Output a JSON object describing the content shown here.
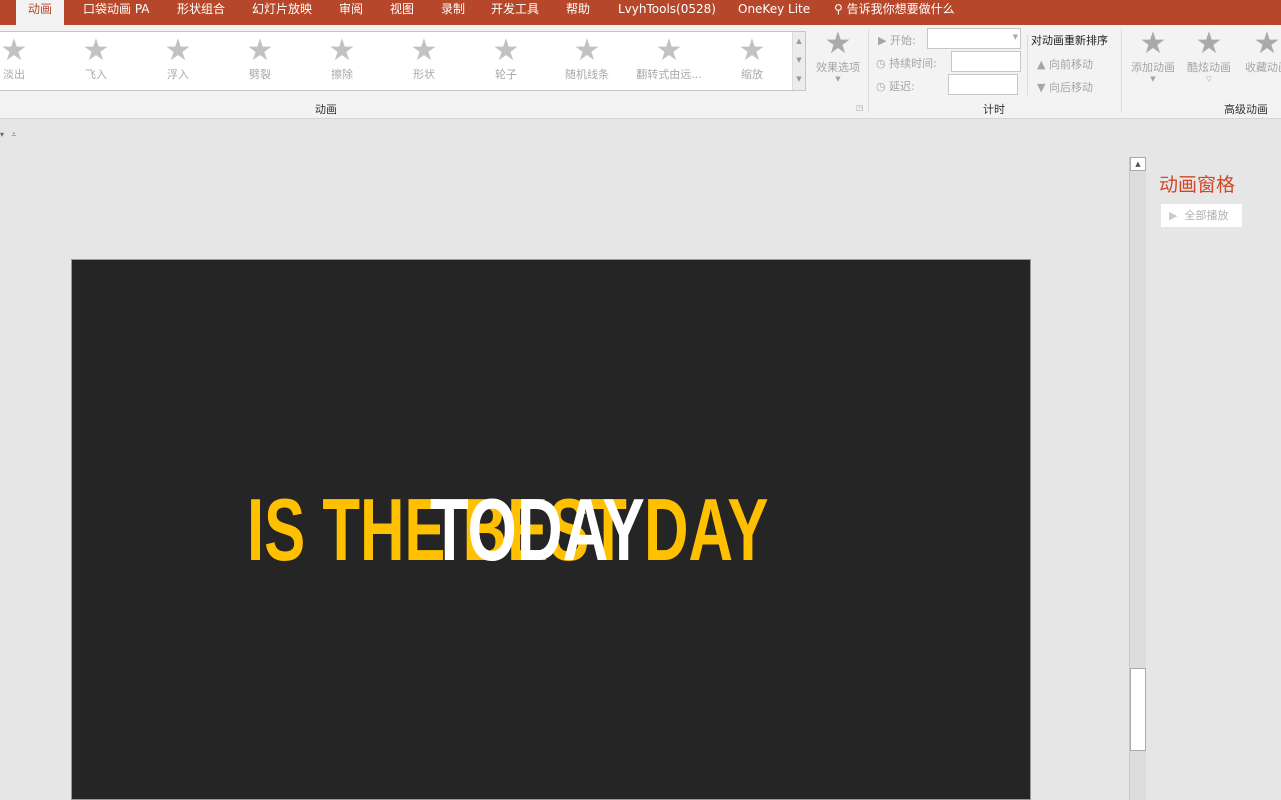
{
  "tabs": [
    "动画",
    "口袋动画 PA",
    "形状组合",
    "幻灯片放映",
    "审阅",
    "视图",
    "录制",
    "开发工具",
    "帮助",
    "LvyhTools(0528)",
    "OneKey Lite"
  ],
  "tell_me": "告诉我你想要做什么",
  "gallery": [
    "淡出",
    "飞入",
    "浮入",
    "劈裂",
    "擦除",
    "形状",
    "轮子",
    "随机线条",
    "翻转式由远...",
    "缩放"
  ],
  "effect_options": "效果选项",
  "groups": {
    "animation": "动画",
    "timing": "计时",
    "advanced": "高级动画"
  },
  "timing": {
    "start": "开始:",
    "duration": "持续时间:",
    "delay": "延迟:",
    "reorder": "对动画重新排序",
    "move_earlier": "向前移动",
    "move_later": "向后移动"
  },
  "advanced": [
    "添加动画",
    "酷炫动画",
    "收藏动画"
  ],
  "pane": {
    "title": "动画窗格",
    "play_all": "全部播放"
  },
  "slide": {
    "line1": "IS THE BEST DAY",
    "line2": "TODAY"
  },
  "colors": {
    "accent": "#b7472a",
    "yellow": "#ffc000",
    "slide_bg": "#262526"
  }
}
